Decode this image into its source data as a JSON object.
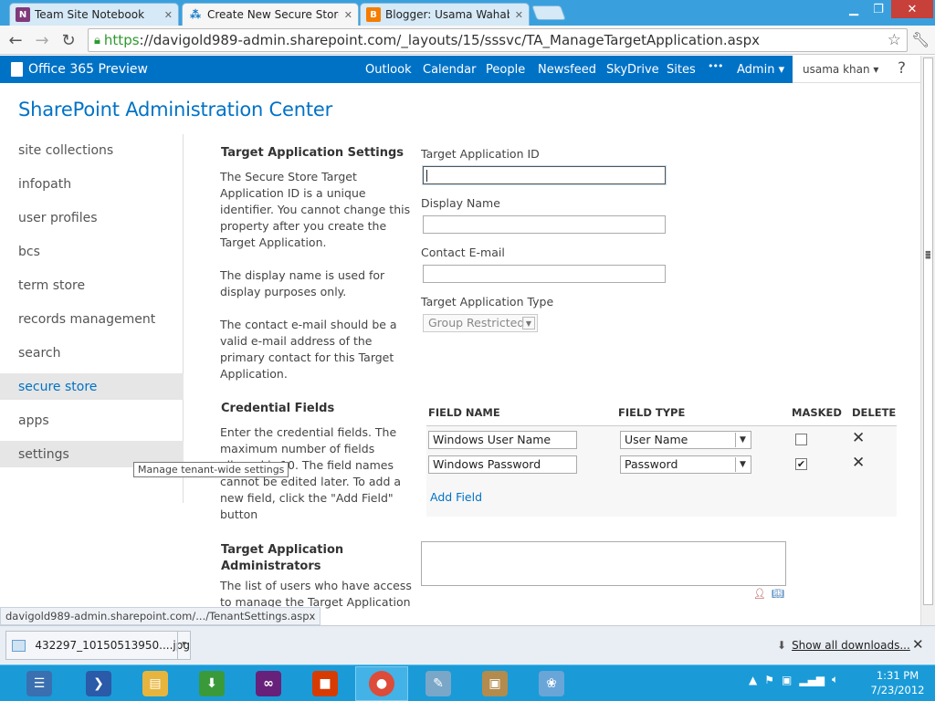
{
  "browser": {
    "tabs": [
      {
        "title": "Team Site Notebook",
        "icon_letter": "N",
        "icon_color": "#80397b"
      },
      {
        "title": "Create New Secure Store T",
        "icon_letter": "",
        "icon_color": "#0072c6"
      },
      {
        "title": "Blogger: Usama Wahab Kh",
        "icon_letter": "B",
        "icon_color": "#f57d00"
      }
    ],
    "url_scheme": "https",
    "url_rest": "://davigold989-admin.sharepoint.com/_layouts/15/sssvc/TA_ManageTargetApplication.aspx"
  },
  "suite": {
    "logo": "Office 365 Preview",
    "links": [
      "Outlook",
      "Calendar",
      "People",
      "Newsfeed",
      "SkyDrive",
      "Sites",
      "•••",
      "Admin ▾"
    ],
    "user": "usama khan ▾",
    "help": "?"
  },
  "page": {
    "title": "SharePoint Administration Center",
    "nav": [
      "site collections",
      "infopath",
      "user profiles",
      "bcs",
      "term store",
      "records management",
      "search",
      "secure store",
      "apps",
      "settings"
    ],
    "selected_nav": "secure store",
    "tooltip": "Manage tenant-wide settings"
  },
  "settings": {
    "heading": "Target Application Settings",
    "desc1": [
      "The Secure Store Target",
      "Application ID is a unique",
      "identifier. You cannot change this",
      "property after you create the",
      "Target Application."
    ],
    "desc2": [
      "The display name is used for",
      "display purposes only."
    ],
    "desc3": [
      "The contact e-mail should be a",
      "valid e-mail address of the",
      "primary contact for this Target",
      "Application."
    ],
    "labels": {
      "app_id": "Target Application ID",
      "display_name": "Display Name",
      "contact_email": "Contact E-mail",
      "app_type": "Target Application Type"
    },
    "app_type_value": "Group Restricted"
  },
  "credentials": {
    "heading": "Credential Fields",
    "desc": [
      "Enter the credential fields. The",
      "maximum number of fields",
      "allowed is 10. The field names",
      "cannot be edited later. To add a",
      "new field, click the \"Add Field\"",
      "button"
    ],
    "columns": [
      "FIELD NAME",
      "FIELD TYPE",
      "MASKED",
      "DELETE"
    ],
    "rows": [
      {
        "name": "Windows User Name",
        "type": "User Name",
        "masked": false
      },
      {
        "name": "Windows Password",
        "type": "Password",
        "masked": true
      }
    ],
    "add_field": "Add Field"
  },
  "admins": {
    "heading1": "Target Application",
    "heading2": "Administrators",
    "desc": [
      "The list of users who have access",
      "to manage the Target Application"
    ]
  },
  "status_url": "davigold989-admin.sharepoint.com/.../TenantSettings.aspx",
  "downloads": {
    "file": "432297_10150513950....jpg",
    "show_all": "Show all downloads..."
  },
  "taskbar": {
    "apps": [
      {
        "name": "server-manager",
        "color": "#3a6fb0",
        "glyph": "☰",
        "open": false
      },
      {
        "name": "powershell",
        "color": "#2a5aa8",
        "glyph": "❯",
        "open": false
      },
      {
        "name": "file-explorer",
        "color": "#e7b53d",
        "glyph": "▤",
        "open": false
      },
      {
        "name": "internet-download-manager",
        "color": "#3a9a3a",
        "glyph": "⬇",
        "open": false
      },
      {
        "name": "visual-studio",
        "color": "#68217a",
        "glyph": "∞",
        "open": false
      },
      {
        "name": "office",
        "color": "#d83b01",
        "glyph": "■",
        "open": false
      },
      {
        "name": "chrome",
        "color": "#dd4b39",
        "glyph": "●",
        "open": true
      },
      {
        "name": "notes",
        "color": "#7aa7c7",
        "glyph": "✎",
        "open": false
      },
      {
        "name": "package-installer",
        "color": "#b38b4d",
        "glyph": "▣",
        "open": false
      },
      {
        "name": "paint",
        "color": "#6aa5d8",
        "glyph": "❀",
        "open": false
      }
    ],
    "time": "1:31 PM",
    "date": "7/23/2012"
  }
}
